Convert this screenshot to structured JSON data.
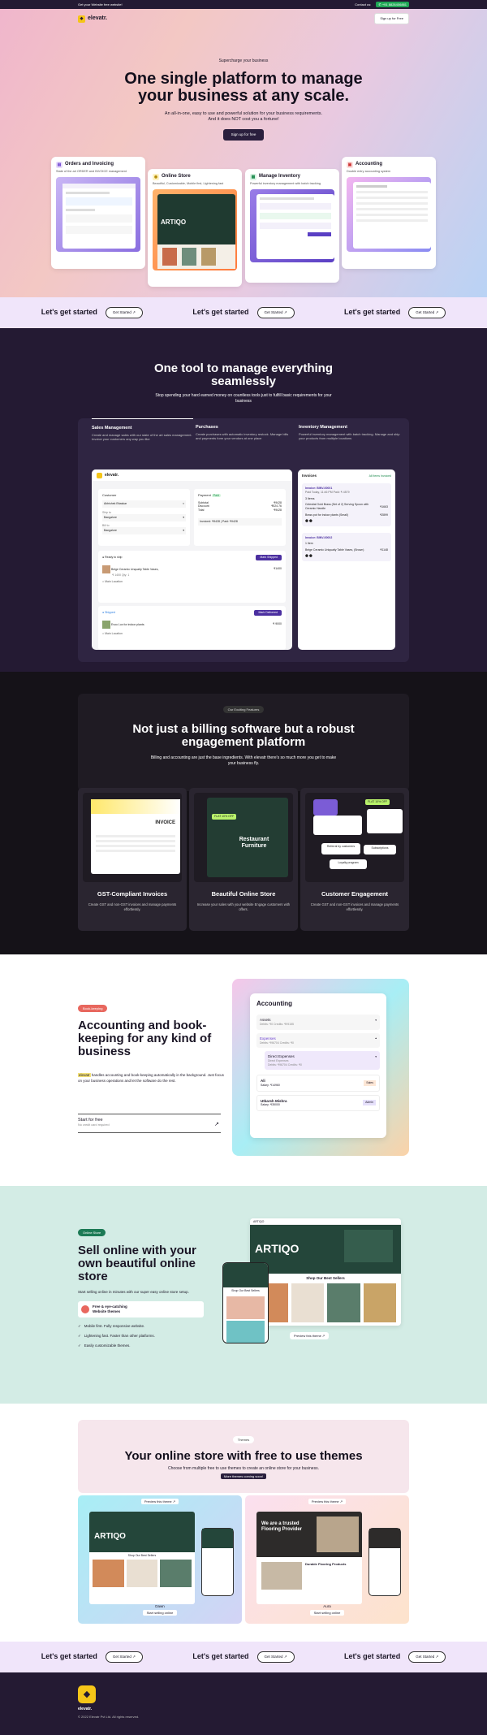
{
  "topbar": {
    "left": "Get your Website free website!",
    "contact": "Contact us:",
    "phone": "+91 8826406881"
  },
  "nav": {
    "brand": "elevatr.",
    "signup": "Sign up for Free"
  },
  "hero": {
    "eyebrow": "Supercharge your business",
    "title": "One single platform to manage your business at any scale.",
    "sub1": "An all-in-one, easy to use and powerful solution for your business requirements.",
    "sub2": "And it does NOT cost you a fortune!",
    "cta": "Sign up for free"
  },
  "hero_cards": [
    {
      "title": "Orders and Invoicing",
      "desc": "State of the art ORDER and INVOICE management"
    },
    {
      "title": "Online Store",
      "desc": "Beautiful, Customizable, Mobile first, Lightening fast"
    },
    {
      "title": "Manage Inventory",
      "desc": "Powerful inventory management with batch tracking"
    },
    {
      "title": "Accounting",
      "desc": "Double entry accounting system"
    }
  ],
  "started": {
    "text": "Let's get started",
    "btn": "Get Started"
  },
  "tool": {
    "title": "One tool to manage everything seamlessly",
    "sub": "Stop spending your hard earned money on countless tools just to fulfill basic requirements for your business",
    "tabs": [
      {
        "title": "Sales Management",
        "desc": "Create and manage sales with our state of the art sales management. Invoice your customers any way you like"
      },
      {
        "title": "Purchases",
        "desc": "Create purchases with automatic inventory restock. Manage bills and payments form your vendors at one place"
      },
      {
        "title": "Inventory Management",
        "desc": "Powerful inventory management with batch tracking. Manage and ship your products from multiple locations"
      }
    ],
    "app": {
      "brand": "elevatr.",
      "customer": "Customer",
      "customer_name": "Abhishek Bhaskar",
      "ship_to": "Ship to",
      "bill_to": "Bill to",
      "city": "Bangalore",
      "payment": "Payment",
      "paid": "Paid",
      "subtotal": "Subtotal",
      "subtotal_v": "₹9428",
      "disc": "Discount",
      "disc_v": "₹524.76",
      "total": "Total",
      "total_v": "₹9428",
      "inv": "Invoiced: ₹9428",
      "paidv": "Paid: ₹9428",
      "ready": "Ready to ship",
      "mark_shipped": "Mark Shipped",
      "item1": "Beige Ceramic Unquaity Table Vases,",
      "item1_q": "₹ 1400 Qty: 1",
      "item1_v": "₹1400",
      "loc": "Main Location",
      "shipped": "Shipped",
      "mark_delivered": "Mark Delivered",
      "item2": "Evoo Lux for indoor plants",
      "item2_v": "₹ 9000",
      "invoices": "Invoices",
      "all_paid": "All Items Invoiced",
      "inv1": "Invoice: BINV-00001",
      "inv1_date": "Paid  Today, 11:46 PM  Paid: ₹ 4579",
      "inv1_items": "3 Items",
      "inv1_a": "Celestial Gold Brass (Set of 2) Serving Spoon with Ceramic Handle",
      "inv1_a_v": "₹1663",
      "inv1_b": "Brass pot for indoor plants (Small)",
      "inv1_b_v": "₹2899",
      "inv2": "Invoice: BINV-00002",
      "inv2_items": "1 Item",
      "inv2_a": "Beige Ceramic Uniquaity Table Vases, (Brown)",
      "inv2_a_v": "₹1148"
    }
  },
  "engage": {
    "badge": "Our Exciting Features",
    "title": "Not just a billing software but a robust engagement platform",
    "sub": "Billing and accounting are just the base ingredients. With elevatr there's so much more you get to make your business fly.",
    "features": [
      {
        "title": "GST-Compliant Invoices",
        "desc": "Create GST and non-GST invoices and manage payments effortlessly."
      },
      {
        "title": "Beautiful Online Store",
        "desc": "Increase your sales with your website Engage customers with offers."
      },
      {
        "title": "Customer Engagement",
        "desc": "Create GST and non-GST invoices and manage payments effortlessly."
      }
    ],
    "invoice_word": "INVOICE",
    "restaurant": "Restaurant Furniture",
    "flat": "FLAT 10% OFF",
    "subscriptions": "Subscriptions",
    "loyalty": "Loyalty program",
    "referral": "Referral by customers"
  },
  "accounting": {
    "badge": "Book-keeping",
    "title": "Accounting and book-keeping for any kind of business",
    "brand_tag": "elevatr",
    "desc": "handles accounting and book-keeping automatically in the background. Just focus on your business operations and let the software do the rest.",
    "cta": "Start for free",
    "cta_sub": "No credit card required",
    "panel_title": "Accounting",
    "assets": "Assets",
    "assets_sub": "Debits: ₹0 Credits: ₹99155",
    "expenses": "Expenses",
    "expenses_sub": "Debits: ₹96704 Credits: ₹0",
    "direct": "Direct Expenses",
    "direct_sub": "Direct Expenses",
    "direct_sub2": "Debits: ₹96704 Credits: ₹0",
    "p1": "Ali",
    "p1_sal": "Salary: ₹14960",
    "p1_role": "Sales",
    "p2": "Utkarsh Mishra",
    "p2_sal": "Salary: ₹35000",
    "p2_role": "Admin"
  },
  "store": {
    "badge": "Online Store",
    "title": "Sell online with your own beautiful online store",
    "desc": "Start selling online in minutes with our super easy online store setup.",
    "promo1": "Free & eye-catching",
    "promo2": "Website themes",
    "checks": [
      "Mobile first. Fully responsive website.",
      "Lightening fast. Faster than other platforms.",
      "Easily customizable themes."
    ],
    "preview": "Preview this theme",
    "shop": "Shop Our Best Sellers",
    "brand": "ARTIQO"
  },
  "themes": {
    "badge": "Themes",
    "title": "Your online store with free to use themes",
    "sub": "Choose from multiple free to use themes to create an online store for your business.",
    "more": "More themes coming soon!",
    "preview": "Preview this theme",
    "t1": "Dawn",
    "t2": "Aura",
    "sell": "Start selling online",
    "trusted": "We are a trusted Flooring Provider",
    "durable": "Durable Flooring Products"
  },
  "footer": {
    "brand": "elevatr.",
    "copy": "© 2022 Elevatr Pvt Ltd. All rights reserved."
  }
}
